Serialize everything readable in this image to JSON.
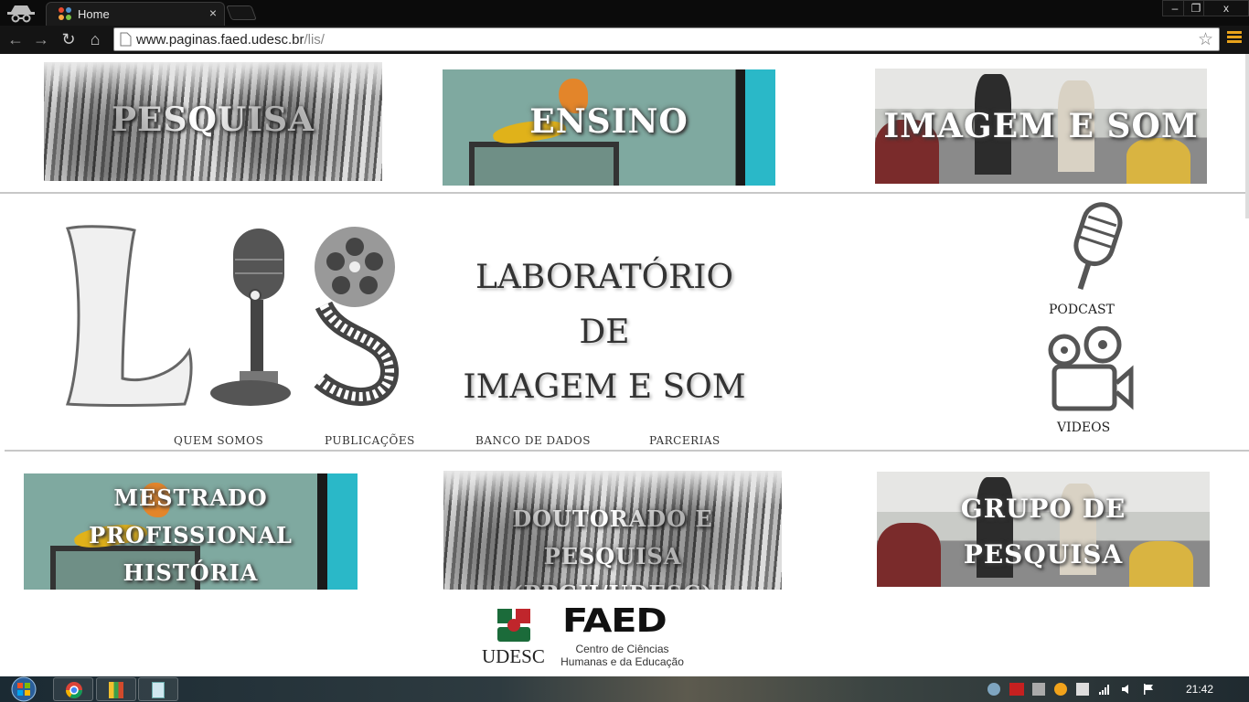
{
  "browser": {
    "tab_title": "Home",
    "tab_close": "×",
    "url_host": "www.paginas.faed.udesc.br",
    "url_path": "/lis/",
    "controls": {
      "minimize": "–",
      "restore": "❐",
      "close": "x"
    },
    "nav": {
      "back": "←",
      "forward": "→",
      "reload": "↻",
      "home": "⌂",
      "star": "☆"
    }
  },
  "top_cards": [
    {
      "label": "PESQUISA"
    },
    {
      "label": "ENSINO"
    },
    {
      "label": "IMAGEM E SOM"
    }
  ],
  "logo": {
    "letter": "L"
  },
  "title": {
    "line1": "LABORATÓRIO",
    "line2": "DE",
    "line3": "IMAGEM E SOM"
  },
  "nav_links": [
    "QUEM SOMOS",
    "PUBLICAÇÕES",
    "BANCO DE DADOS",
    "PARCERIAS"
  ],
  "side": {
    "podcast": "PODCAST",
    "videos": "VIDEOS"
  },
  "bottom_cards": [
    {
      "line1": "MESTRADO",
      "line2": "PROFISSIONAL",
      "line3": "HISTÓRIA"
    },
    {
      "line1": "DOUTORADO E PESQUISA",
      "line2": "(PPGH/UDESC)"
    },
    {
      "line1": "GRUPO DE",
      "line2": "PESQUISA"
    }
  ],
  "footer": {
    "udesc": "UDESC",
    "faed": "FAED",
    "faed_line1": "Centro de Ciências",
    "faed_line2": "Humanas e da Educação"
  },
  "taskbar": {
    "clock": "21:42"
  },
  "colors": {
    "accent_orange": "#e8a21b",
    "page_bg": "#ffffff",
    "text_dark": "#333333"
  }
}
